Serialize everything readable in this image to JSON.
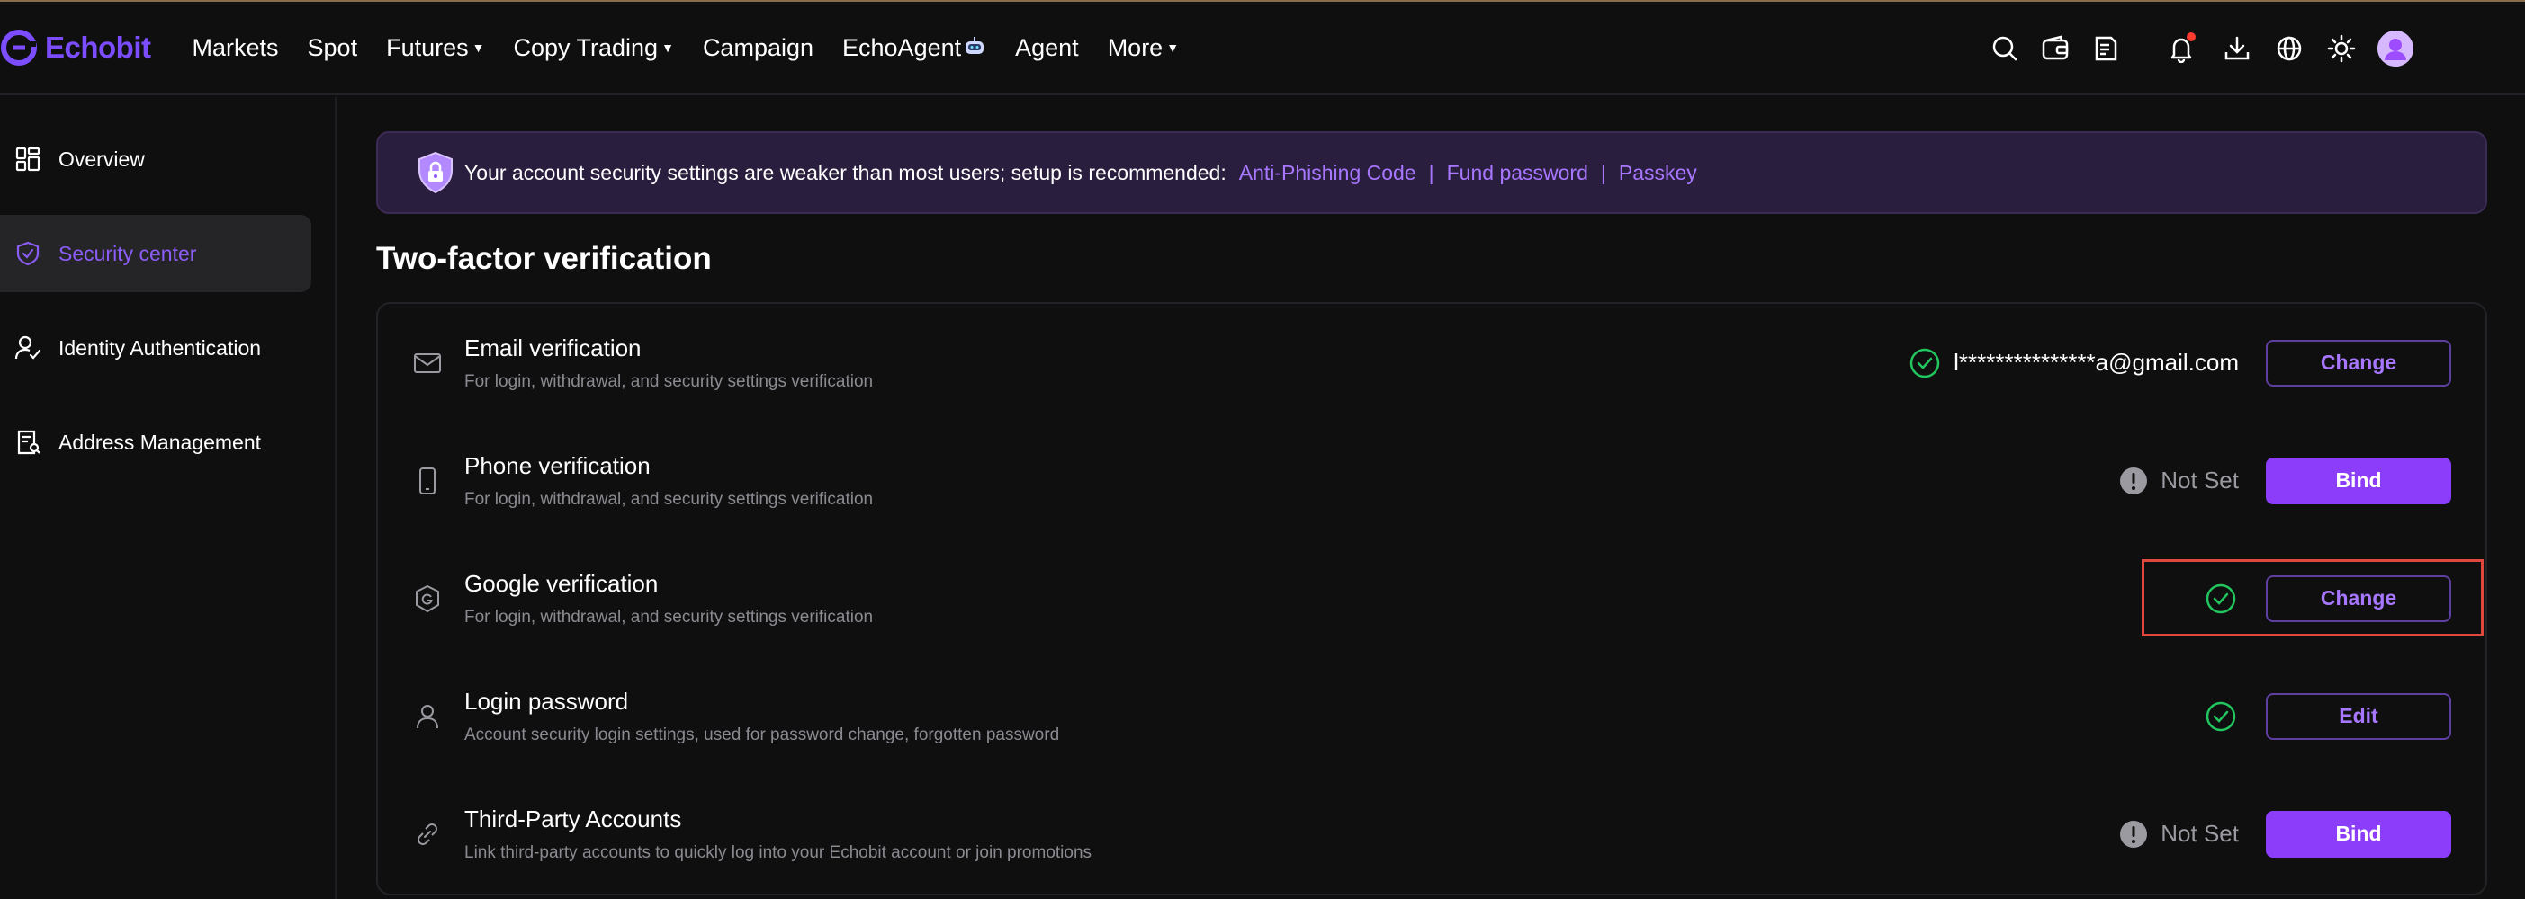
{
  "brand": {
    "name": "Echobit",
    "accent": "#7c4dff"
  },
  "nav": [
    {
      "label": "Markets",
      "dropdown": false
    },
    {
      "label": "Spot",
      "dropdown": false
    },
    {
      "label": "Futures",
      "dropdown": true
    },
    {
      "label": "Copy Trading",
      "dropdown": true
    },
    {
      "label": "Campaign",
      "dropdown": false
    },
    {
      "label": "EchoAgent",
      "dropdown": false,
      "icon": "robot-icon"
    },
    {
      "label": "Agent",
      "dropdown": false
    },
    {
      "label": "More",
      "dropdown": true
    }
  ],
  "header_icons": [
    "search-icon",
    "wallet-icon",
    "orders-icon",
    "bell-icon",
    "download-icon",
    "globe-icon",
    "sun-icon",
    "avatar"
  ],
  "sidebar": {
    "items": [
      {
        "label": "Overview",
        "icon": "grid-icon",
        "active": false
      },
      {
        "label": "Security center",
        "icon": "shield-check-icon",
        "active": true
      },
      {
        "label": "Identity Authentication",
        "icon": "user-check-icon",
        "active": false
      },
      {
        "label": "Address Management",
        "icon": "address-book-icon",
        "active": false
      }
    ]
  },
  "banner": {
    "text": "Your account security settings are weaker than most users; setup is recommended:",
    "links": [
      "Anti-Phishing Code",
      "Fund password",
      "Passkey"
    ],
    "separator": "|"
  },
  "section_title": "Two-factor verification",
  "rows": [
    {
      "title": "Email verification",
      "desc": "For login, withdrawal, and security settings verification",
      "icon": "mail-icon",
      "status": "ok",
      "status_text": "l***************a@gmail.com",
      "button": "Change",
      "button_style": "outline"
    },
    {
      "title": "Phone verification",
      "desc": "For login, withdrawal, and security settings verification",
      "icon": "phone-icon",
      "status": "warn",
      "status_text": "Not Set",
      "button": "Bind",
      "button_style": "solid"
    },
    {
      "title": "Google verification",
      "desc": "For login, withdrawal, and security settings verification",
      "icon": "google-shield-icon",
      "status": "ok",
      "status_text": "",
      "button": "Change",
      "button_style": "outline"
    },
    {
      "title": "Login password",
      "desc": "Account security login settings, used for password change, forgotten password",
      "icon": "user-icon",
      "status": "ok",
      "status_text": "",
      "button": "Edit",
      "button_style": "outline"
    },
    {
      "title": "Third-Party Accounts",
      "desc": "Link third-party accounts to quickly log into your Echobit account or join promotions",
      "icon": "link-icon",
      "status": "warn",
      "status_text": "Not Set",
      "button": "Bind",
      "button_style": "solid"
    }
  ],
  "colors": {
    "ok": "#22c55e",
    "warn": "#9a9aa0",
    "button_solid": "#8b3dfa",
    "link": "#a777ff",
    "highlight": "#e0473d"
  }
}
